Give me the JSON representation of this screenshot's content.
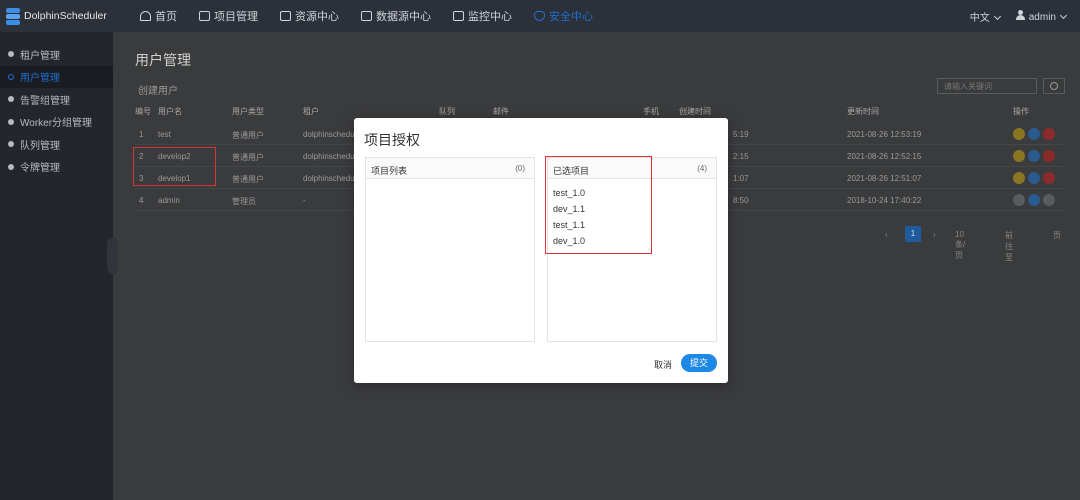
{
  "app": {
    "name": "DolphinScheduler"
  },
  "nav": [
    {
      "label": "首页",
      "icon": "home-icon"
    },
    {
      "label": "项目管理",
      "icon": "project-icon"
    },
    {
      "label": "资源中心",
      "icon": "folder-icon"
    },
    {
      "label": "数据源中心",
      "icon": "database-icon"
    },
    {
      "label": "监控中心",
      "icon": "monitor-icon"
    },
    {
      "label": "安全中心",
      "icon": "shield-icon",
      "active": true
    }
  ],
  "header": {
    "language": "中文",
    "user": "admin"
  },
  "sidebar": {
    "items": [
      {
        "label": "租户管理"
      },
      {
        "label": "用户管理",
        "active": true
      },
      {
        "label": "告警组管理"
      },
      {
        "label": "Worker分组管理"
      },
      {
        "label": "队列管理"
      },
      {
        "label": "令牌管理"
      }
    ]
  },
  "page": {
    "title": "用户管理",
    "create_button": "创建用户",
    "search_placeholder": "请输入关键词"
  },
  "table": {
    "headers": [
      "编号",
      "用户名",
      "用户类型",
      "租户",
      "队列",
      "邮件",
      "手机",
      "创建时间",
      "更新时间",
      "操作"
    ],
    "rows": [
      {
        "no": "1",
        "name": "test",
        "type": "普通用户",
        "tenant": "dolphinscheduler",
        "created": "5:19",
        "updated": "2021-08-26 12:53:19"
      },
      {
        "no": "2",
        "name": "develop2",
        "type": "普通用户",
        "tenant": "dolphinscheduler",
        "created": "2:15",
        "updated": "2021-08-26 12:52:15"
      },
      {
        "no": "3",
        "name": "develop1",
        "type": "普通用户",
        "tenant": "dolphinscheduler",
        "created": "1:07",
        "updated": "2021-08-26 12:51:07"
      },
      {
        "no": "4",
        "name": "admin",
        "type": "管理员",
        "tenant": "-",
        "created": "8:50",
        "updated": "2018-10-24 17:40:22"
      }
    ]
  },
  "pager": {
    "current": "1",
    "page_size": "10条/页",
    "jump": "前往至",
    "tail": "页"
  },
  "modal": {
    "title": "项目授权",
    "left_panel": {
      "title": "项目列表",
      "count": "(0)",
      "items": []
    },
    "right_panel": {
      "title": "已选项目",
      "count": "(4)",
      "items": [
        "test_1.0",
        "dev_1.1",
        "test_1.1",
        "dev_1.0"
      ]
    },
    "cancel": "取消",
    "submit": "提交"
  },
  "colors": {
    "accent": "#1e88e5",
    "highlight": "#dd3333",
    "topbar": "#2c3038"
  }
}
